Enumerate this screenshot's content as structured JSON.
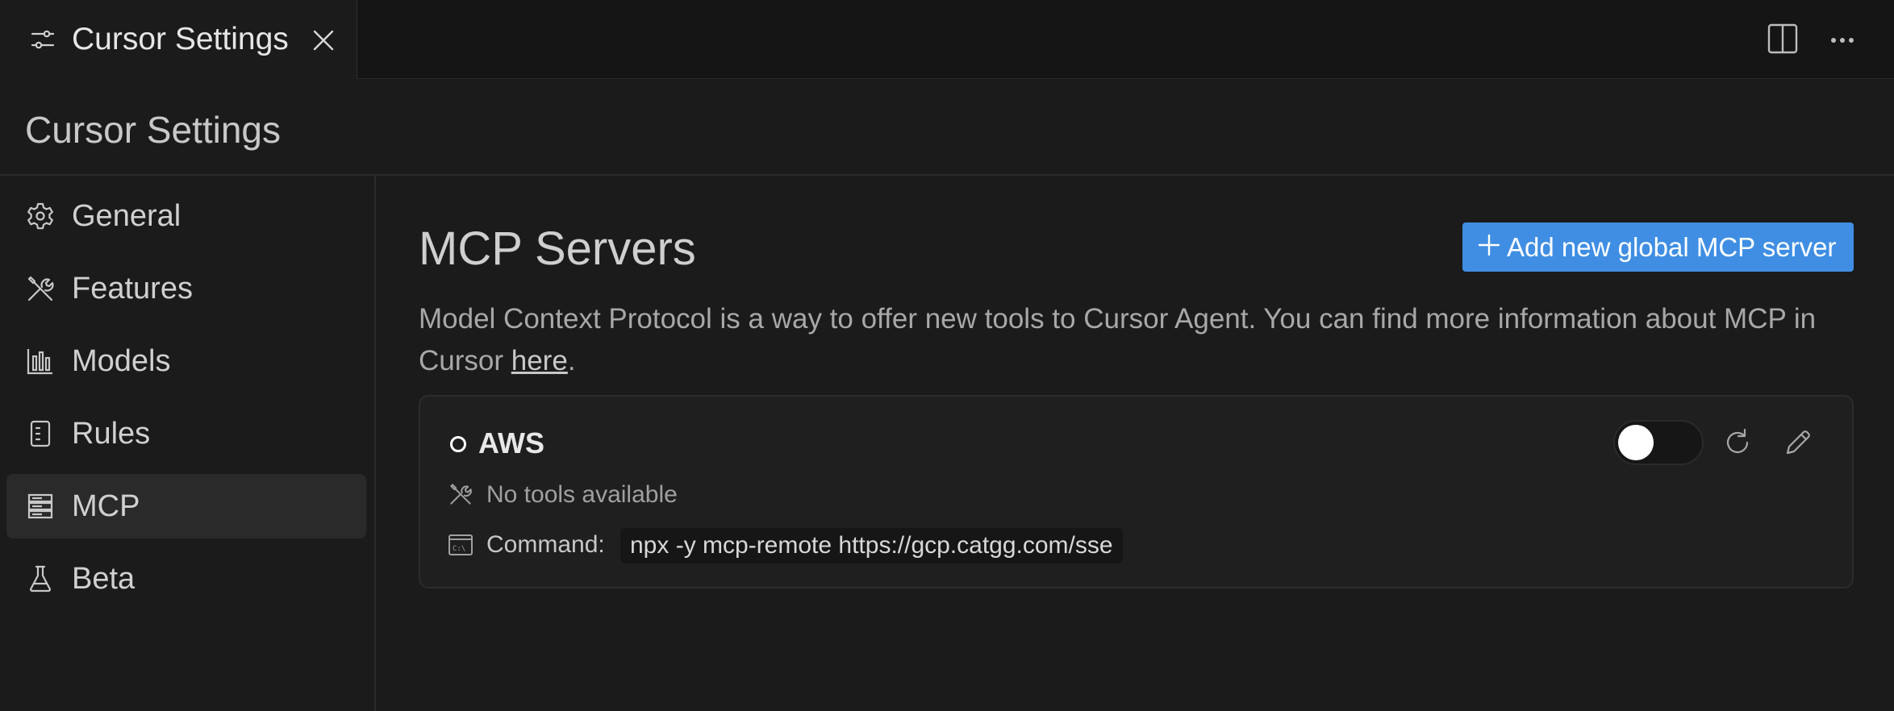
{
  "tab": {
    "title": "Cursor Settings",
    "icon": "settings-sliders-icon"
  },
  "page": {
    "title": "Cursor Settings"
  },
  "sidebar": {
    "items": [
      {
        "label": "General",
        "icon": "gear-icon",
        "active": false
      },
      {
        "label": "Features",
        "icon": "tools-icon",
        "active": false
      },
      {
        "label": "Models",
        "icon": "bar-chart-icon",
        "active": false
      },
      {
        "label": "Rules",
        "icon": "document-icon",
        "active": false
      },
      {
        "label": "MCP",
        "icon": "server-icon",
        "active": true
      },
      {
        "label": "Beta",
        "icon": "flask-icon",
        "active": false
      }
    ]
  },
  "main": {
    "title": "MCP Servers",
    "add_button_label": "Add new global MCP server",
    "description_before": "Model Context Protocol is a way to offer new tools to Cursor Agent. You can find more information about MCP in Cursor ",
    "description_link": "here",
    "description_after": "."
  },
  "server": {
    "name": "AWS",
    "enabled": false,
    "tools_text": "No tools available",
    "command_label": "Command:",
    "command_value": "npx -y mcp-remote https://gcp.catgg.com/sse"
  },
  "colors": {
    "accent": "#3f8ee3",
    "background": "#1b1b1b"
  }
}
